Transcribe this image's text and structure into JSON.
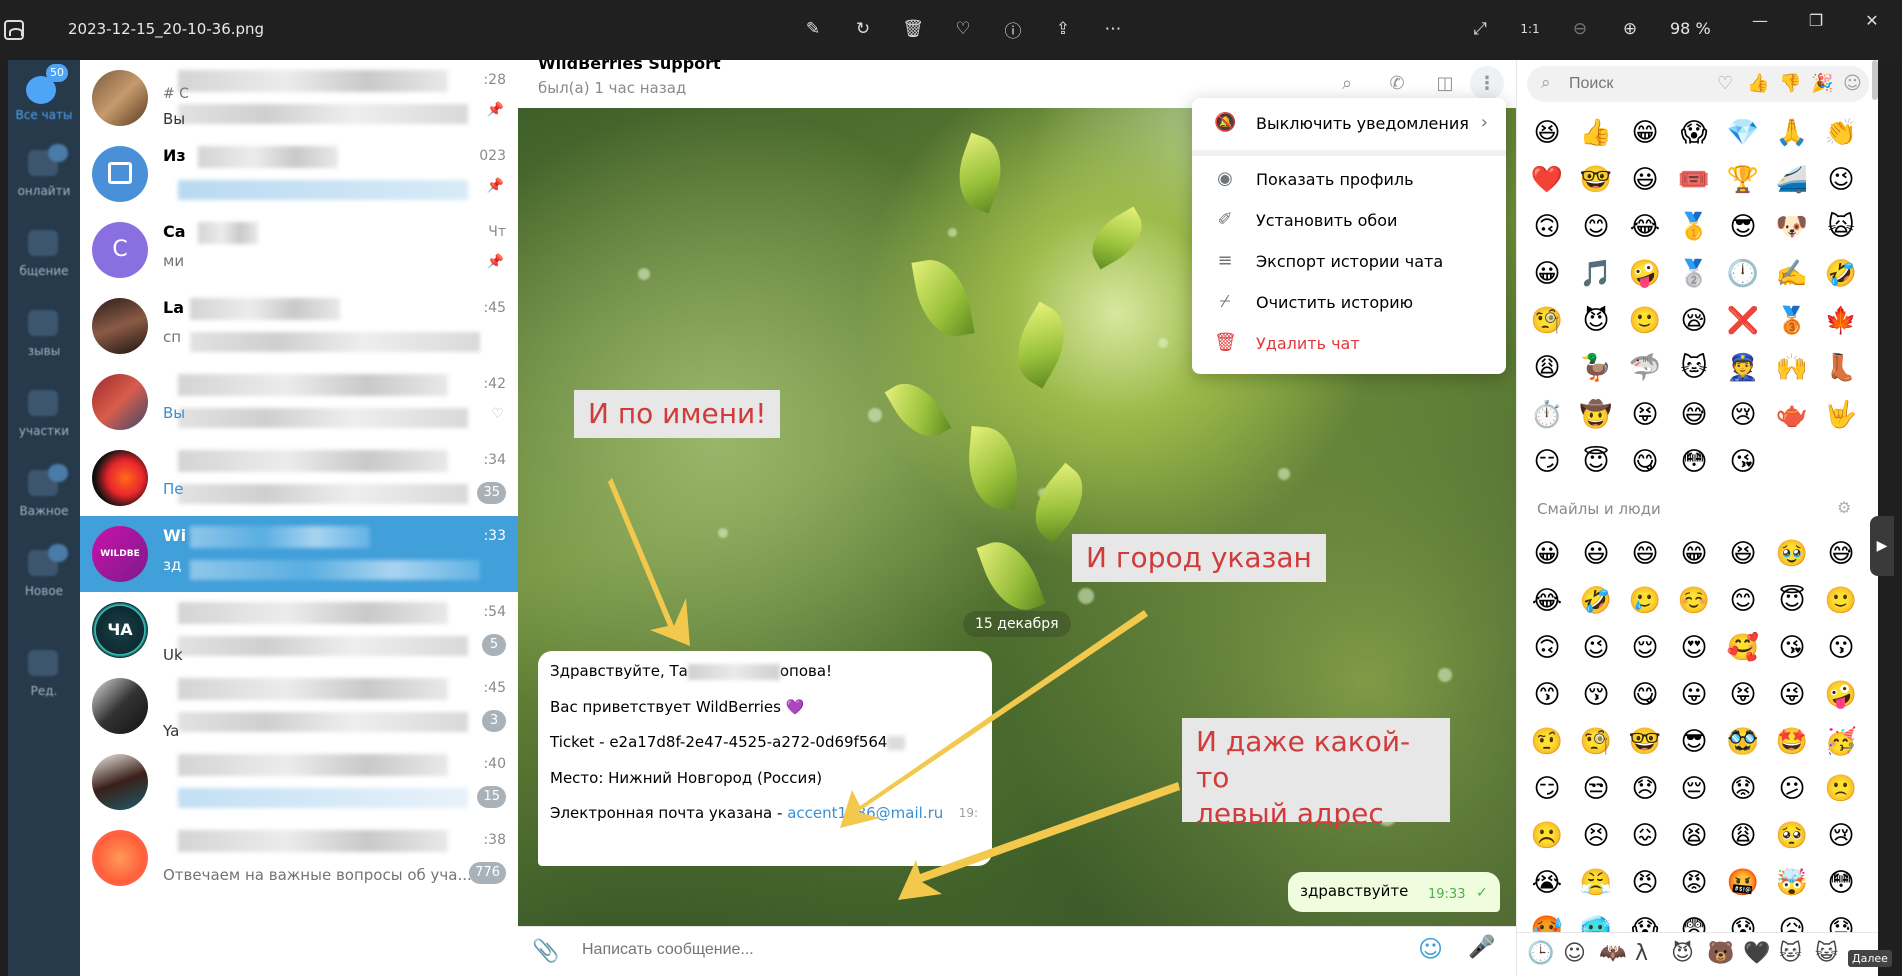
{
  "viewer": {
    "filename": "2023-12-15_20-10-36.png",
    "zoom": "98 %",
    "tools": [
      "edit-icon",
      "rotate-icon",
      "delete-icon",
      "favorite-icon",
      "info-icon",
      "share-icon",
      "more-icon"
    ]
  },
  "rail": {
    "items": [
      {
        "label": "Все чаты",
        "badge": "50"
      },
      {
        "label": "",
        "badge": ""
      },
      {
        "label": "",
        "badge": ""
      },
      {
        "label": "",
        "badge": ""
      },
      {
        "label": "",
        "badge": ""
      },
      {
        "label": "",
        "badge": ""
      },
      {
        "label": "",
        "badge": ""
      },
      {
        "label": "Ред.",
        "badge": ""
      }
    ]
  },
  "chatlist": {
    "rows": [
      {
        "name": "",
        "preview": "# С",
        "preview2": "Вы",
        "time": ":28",
        "pin": true,
        "count": ""
      },
      {
        "name": "Из",
        "preview": "",
        "time": "023",
        "pin": true,
        "count": ""
      },
      {
        "name": "Са",
        "preview": "ми",
        "time": "Чт",
        "pin": true,
        "count": ""
      },
      {
        "name": "La",
        "preview": "сп",
        "time": ":45",
        "pin": false,
        "count": ""
      },
      {
        "name": "",
        "preview": "Вы",
        "time": ":42",
        "pin": false,
        "count": ""
      },
      {
        "name": "",
        "preview": "Пе",
        "time": ":34",
        "pin": false,
        "count": "35"
      },
      {
        "name": "Wi",
        "preview": "зд",
        "time": ":33",
        "pin": false,
        "count": "",
        "active": true
      },
      {
        "name": "",
        "preview": "Uk",
        "time": ":54",
        "pin": false,
        "count": "5"
      },
      {
        "name": "",
        "preview": "Ya",
        "time": ":45",
        "pin": false,
        "count": "3"
      },
      {
        "name": "",
        "preview": "",
        "time": ":40",
        "pin": false,
        "count": "15"
      },
      {
        "name": "",
        "preview": "Отвечаем на важные вопросы об уча...",
        "time": ":38",
        "pin": false,
        "count": "776"
      }
    ]
  },
  "chat": {
    "title": "WildBerries Support",
    "status": "был(а) 1 час назад",
    "date_chip": "15 декабря",
    "incoming": {
      "line1_prefix": "Здравствуйте, Та",
      "line1_suffix": "опова!",
      "line2": "Вас приветствует WildBerries 💜",
      "line3": "Ticket - e2a17d8f-2e47-4525-a272-0d69f564",
      "line4": "Место: Нижний Новгород (Россия)",
      "line5_prefix": "Электронная почта указана - ",
      "line5_email": "accent1986@mail.ru",
      "time": "19:"
    },
    "outgoing": {
      "text": "здравствуйте",
      "time": "19:33"
    },
    "composer_placeholder": "Написать сообщение..."
  },
  "annotations": {
    "name": "И по имени!",
    "city": "И город указан",
    "address_line1": "И даже какой-то",
    "address_line2": "левый адрес"
  },
  "menu": {
    "items": [
      {
        "label": "Выключить уведомления",
        "icon": "mute-icon",
        "submenu": true
      },
      {
        "label": "Показать профиль",
        "icon": "profile-icon"
      },
      {
        "label": "Установить обои",
        "icon": "brush-icon"
      },
      {
        "label": "Экспорт истории чата",
        "icon": "export-icon"
      },
      {
        "label": "Очистить историю",
        "icon": "broom-icon"
      },
      {
        "label": "Удалить чат",
        "icon": "trash-icon",
        "danger": true
      }
    ]
  },
  "emoji_panel": {
    "search_placeholder": "Поиск",
    "recent": [
      "😆",
      "👍",
      "😁",
      "😱",
      "💎",
      "🙏",
      "👏",
      "❤️",
      "🤓",
      "😃",
      "🎟️",
      "🏆",
      "🚄",
      "😉",
      "🙃",
      "😊",
      "😂",
      "🥇",
      "😎",
      "🐶",
      "🙀",
      "😀",
      "🎵",
      "🤪",
      "🥈",
      "🕛",
      "✍️",
      "🤣",
      "🧐",
      "😈",
      "🙂",
      "😪",
      "❌",
      "🥉",
      "🍁",
      "😩",
      "🦆",
      "🦈",
      "🐱",
      "👮",
      "🙌",
      "👢",
      "⏱️",
      "🤠",
      "😝",
      "😅",
      "😢",
      "🫖",
      "🤟",
      "😏",
      "😇",
      "😋",
      "😳",
      "😘"
    ],
    "section_title": "Смайлы и люди",
    "people": [
      "😀",
      "😃",
      "😄",
      "😁",
      "😆",
      "🥹",
      "😅",
      "😂",
      "🤣",
      "🥲",
      "☺️",
      "😊",
      "😇",
      "🙂",
      "🙃",
      "😉",
      "😌",
      "😍",
      "🥰",
      "😘",
      "😗",
      "😙",
      "😚",
      "😋",
      "😛",
      "😝",
      "😜",
      "🤪",
      "🤨",
      "🧐",
      "🤓",
      "😎",
      "🥸",
      "🤩",
      "🥳",
      "😏",
      "😒",
      "😞",
      "😔",
      "😟",
      "😕",
      "🙁",
      "☹️",
      "😣",
      "😖",
      "😫",
      "😩",
      "🥺",
      "😢",
      "😭",
      "😤",
      "😠",
      "😡",
      "🤬",
      "🤯",
      "😳",
      "🥵",
      "🥶",
      "😱",
      "😨",
      "😰",
      "😥",
      "😓"
    ],
    "bottom": [
      "🕒",
      "☺",
      "🦇",
      "λ",
      "😈",
      "🐻",
      "🖤",
      "🐱",
      "😺"
    ],
    "more_label": "Далее"
  }
}
